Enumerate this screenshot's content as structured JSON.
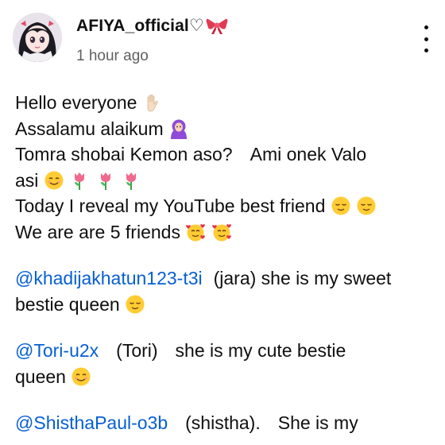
{
  "post": {
    "author": "AFIYA_official♡",
    "time": "1 hour ago"
  },
  "icons": {
    "avatar": "anime-girl-avatar",
    "author_badge": "ribbon-bow-icon",
    "menu": "more-vertical-icon"
  },
  "body": {
    "l1": "Hello everyone",
    "l2": "Assalamu alaikum",
    "l3a": "Tomra shobai Kemon aso?",
    "l3b": "Ami  onek Valo",
    "l4": "asi",
    "l5": "Today I reveal my YouTube best friend",
    "l6": "We are are 5 friends",
    "m1_handle": "@khadijakhatun123-t3i",
    "m1_text": "(jara) she is my sweet",
    "m1_cont": "bestie queen",
    "m2_handle": "@Tori-u2x",
    "m2_name": "(Tori)",
    "m2_text": "she is my cute bestie",
    "m2_cont": "queen",
    "m3_handle": "@ShisthaPaul-o3b",
    "m3_name": "(shistha).",
    "m3_text": "She is my"
  },
  "colors": {
    "link": "#065fd4",
    "text": "#0f0f0f",
    "muted": "#606060"
  }
}
